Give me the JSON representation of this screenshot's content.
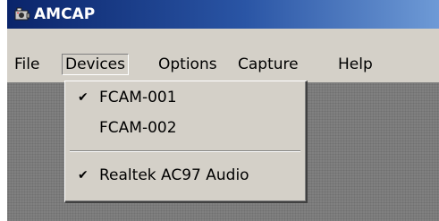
{
  "window": {
    "title": "AMCAP"
  },
  "menubar": {
    "items": [
      {
        "label": "File"
      },
      {
        "label": "Devices",
        "open": true
      },
      {
        "label": "Options"
      },
      {
        "label": "Capture"
      },
      {
        "label": "Help"
      }
    ]
  },
  "devices_menu": {
    "items": [
      {
        "label": "FCAM-001",
        "checked": true
      },
      {
        "label": "FCAM-002",
        "checked": false
      },
      {
        "separator": true
      },
      {
        "label": "Realtek AC97 Audio",
        "checked": true
      }
    ],
    "check_glyph": "✔"
  },
  "colors": {
    "titlebar_start": "#0a246a",
    "titlebar_end": "#6e9ad6",
    "face": "#d4d0c8",
    "client": "#808080"
  }
}
